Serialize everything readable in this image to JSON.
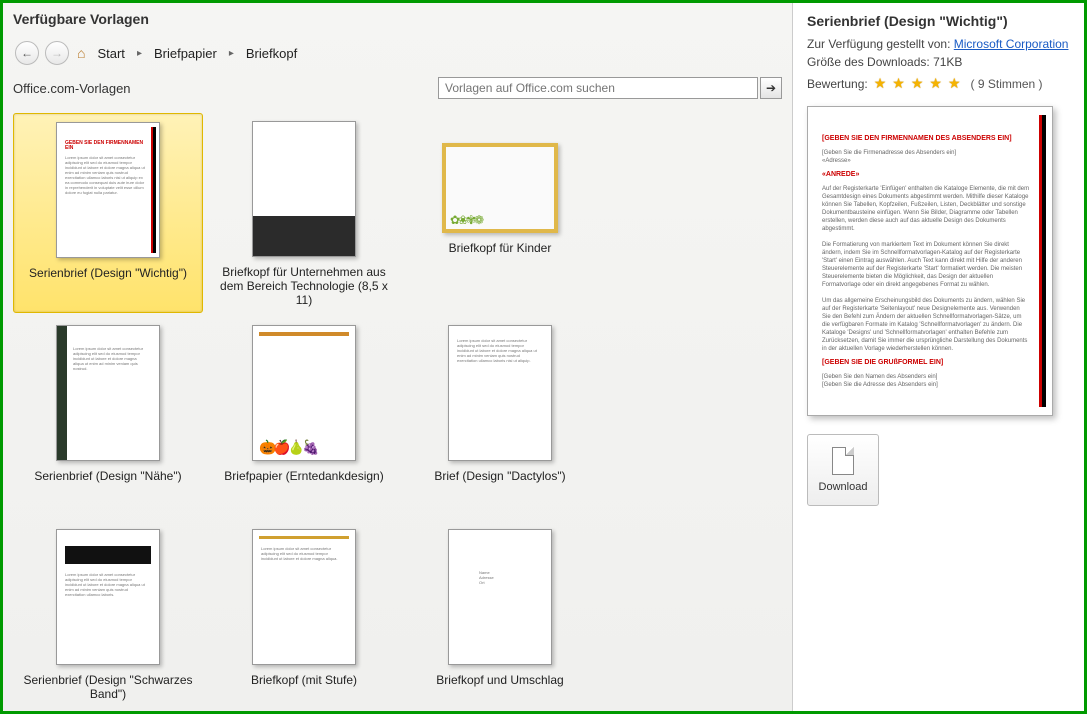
{
  "header": {
    "title": "Verfügbare Vorlagen"
  },
  "breadcrumb": {
    "items": [
      "Start",
      "Briefpapier",
      "Briefkopf"
    ]
  },
  "strip": {
    "label": "Office.com-Vorlagen",
    "search_placeholder": "Vorlagen auf Office.com suchen"
  },
  "gallery": {
    "items": [
      {
        "label": "Serienbrief (Design \"Wichtig\")",
        "selected": true,
        "variant": "wichtig"
      },
      {
        "label": "Briefkopf für Unternehmen aus dem Bereich Technologie (8,5 x 11)",
        "selected": false,
        "variant": "tech"
      },
      {
        "label": "Briefkopf für Kinder",
        "selected": false,
        "variant": "kids"
      },
      {
        "label": "Serienbrief (Design \"Nähe\")",
        "selected": false,
        "variant": "naehe"
      },
      {
        "label": "Briefpapier (Erntedankdesign)",
        "selected": false,
        "variant": "ernte"
      },
      {
        "label": "Brief (Design \"Dactylos\")",
        "selected": false,
        "variant": "dactylos"
      },
      {
        "label": "Serienbrief (Design \"Schwarzes Band\")",
        "selected": false,
        "variant": "band"
      },
      {
        "label": "Briefkopf (mit Stufe)",
        "selected": false,
        "variant": "stufe"
      },
      {
        "label": "Briefkopf und Umschlag",
        "selected": false,
        "variant": "umschlag"
      }
    ]
  },
  "detail": {
    "title": "Serienbrief (Design \"Wichtig\")",
    "provided_by_label": "Zur Verfügung gestellt von:",
    "provided_by_value": "Microsoft Corporation",
    "size_label": "Größe des Downloads:",
    "size_value": "71KB",
    "rating_label": "Bewertung:",
    "votes": "( 9 Stimmen )",
    "download_label": "Download",
    "preview_heading": "[GEBEN SIE DEN FIRMENNAMEN DES ABSENDERS EIN]",
    "preview_salutation": "«ANREDE»",
    "preview_footer": "[GEBEN SIE DIE GRUßFORMEL EIN]"
  }
}
